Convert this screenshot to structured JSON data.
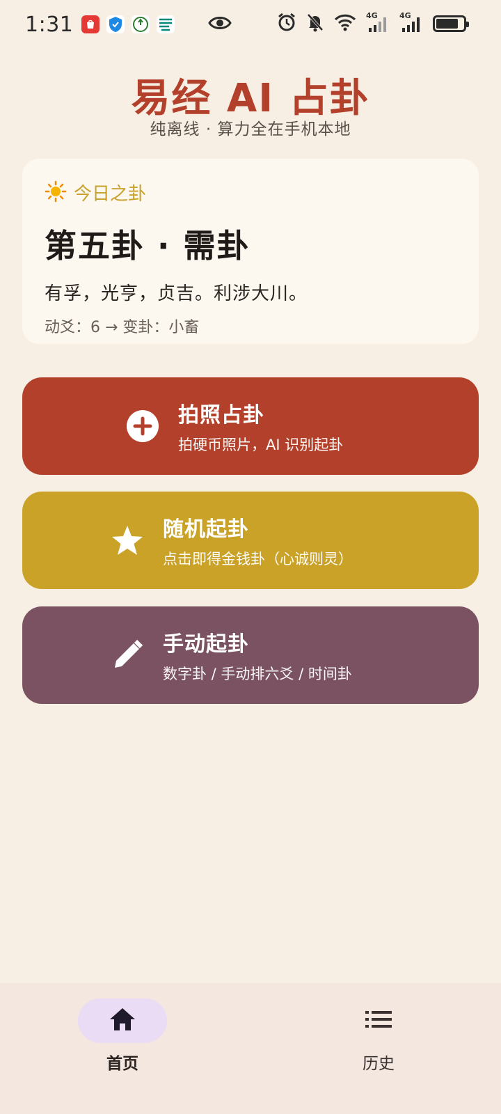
{
  "status_bar": {
    "time": "1:31",
    "signal_1": "4G",
    "signal_2": "4G"
  },
  "header": {
    "title": "易经 AI 占卦",
    "subtitle": "纯离线 · 算力全在手机本地"
  },
  "today_card": {
    "label": "今日之卦",
    "icon": "sun-icon",
    "hexagram_title": "第五卦 · 需卦",
    "judgment": "有孚，光亨，贞吉。利涉大川。",
    "moving_line": "动爻：6 → 变卦：小畜"
  },
  "actions": [
    {
      "title": "拍照占卦",
      "desc": "拍硬币照片，AI 识别起卦",
      "icon": "plus-circle-icon",
      "color": "#b3402a"
    },
    {
      "title": "随机起卦",
      "desc": "点击即得金钱卦（心诚则灵）",
      "icon": "star-icon",
      "color": "#c9a227"
    },
    {
      "title": "手动起卦",
      "desc": "数字卦 / 手动排六爻 / 时间卦",
      "icon": "pencil-icon",
      "color": "#7b5261"
    }
  ],
  "bottom_nav": [
    {
      "label": "首页",
      "icon": "home-icon",
      "selected": true
    },
    {
      "label": "历史",
      "icon": "list-icon",
      "selected": false
    }
  ]
}
